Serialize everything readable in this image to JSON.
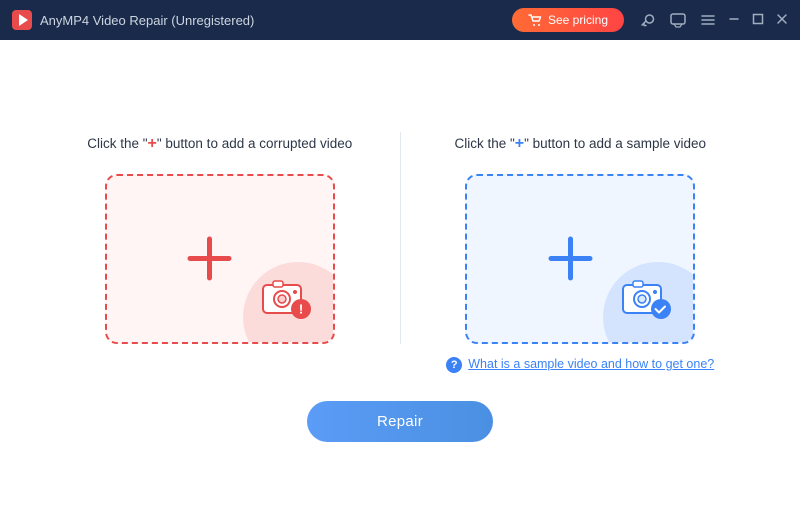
{
  "titleBar": {
    "title": "AnyMP4 Video Repair (Unregistered)",
    "pricingLabel": "See pricing",
    "logoAlt": "AnyMP4 logo"
  },
  "panels": {
    "left": {
      "instruction_prefix": "Click the \"",
      "instruction_plus": "+",
      "instruction_suffix": "\" button to add a corrupted video"
    },
    "right": {
      "instruction_prefix": "Click the \"",
      "instruction_plus": "+",
      "instruction_suffix": "\" button to add a sample video",
      "helpLink": "What is a sample video and how to get one?"
    }
  },
  "repairButton": {
    "label": "Repair"
  }
}
